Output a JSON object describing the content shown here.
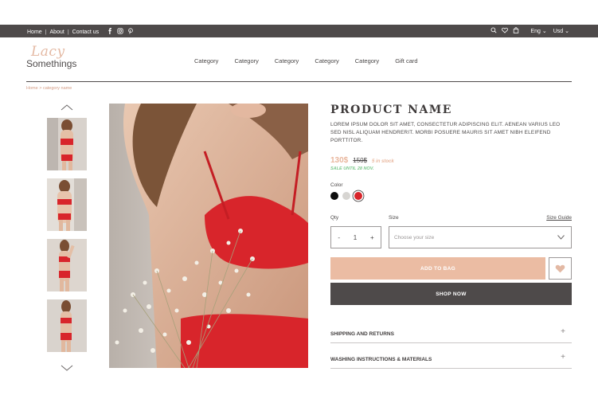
{
  "topbar": {
    "links": [
      "Home",
      "About",
      "Contact us"
    ],
    "social": [
      "facebook-icon",
      "instagram-icon",
      "pinterest-icon"
    ],
    "language": "Eng",
    "currency": "Usd"
  },
  "logo": {
    "script": "Lacy",
    "sans": "Somethings"
  },
  "nav": [
    "Category",
    "Category",
    "Category",
    "Category",
    "Category",
    "Gift card"
  ],
  "breadcrumb": "Home  >  category name",
  "product": {
    "name": "PRODUCT NAME",
    "description": "LOREM IPSUM DOLOR SIT AMET, CONSECTETUR ADIPISCING ELIT. AENEAN VARIUS LEO SED NISL ALIQUAM HENDRERIT. MORBI POSUERE MAURIS SIT AMET NIBH ELEIFEND PORTTITOR.",
    "price": "130$",
    "old_price": "150$",
    "stock": "5 in stock",
    "sale": "SALE UNTIL 28 NOV.",
    "color_label": "Color",
    "colors": [
      "#0d0d0d",
      "#d7d5d2",
      "#d8252b"
    ],
    "selected_color_index": 2,
    "qty_label": "Qty",
    "size_label": "Size",
    "size_guide": "Size Guide",
    "qty_minus": "-",
    "qty_value": "1",
    "qty_plus": "+",
    "size_placeholder": "Choose your size",
    "add_to_bag": "ADD TO BAG",
    "shop_now": "SHOP NOW",
    "accordion": [
      {
        "title": "SHIPPING AND RETURNS",
        "toggle": "+"
      },
      {
        "title": "WASHING INSTRUCTIONS & MATERIALS",
        "toggle": "+"
      }
    ]
  },
  "colors": {
    "dark": "#4e4a4a",
    "accent": "#ebbca3",
    "sale": "#7ec98e",
    "product_red": "#d8252b"
  }
}
